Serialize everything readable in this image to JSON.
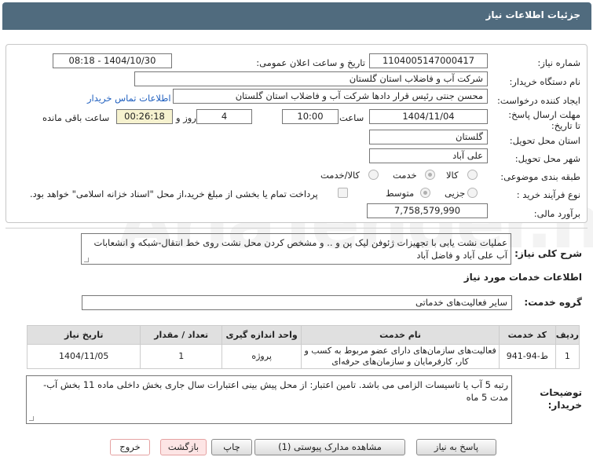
{
  "header": {
    "title": "جزئیات اطلاعات نیاز"
  },
  "watermark": "AriaTender.net",
  "form": {
    "need_number_label": "شماره نیاز:",
    "need_number": "1104005147000417",
    "announce_label": "تاریخ و ساعت اعلان عمومی:",
    "announce_value": "1404/10/30 - 08:18",
    "buyer_label": "نام دستگاه خریدار:",
    "buyer_value": "شرکت آب و فاضلاب استان گلستان",
    "creator_label": "ایجاد کننده درخواست:",
    "creator_value": "محسن جنتی رئیس قرار دادها شرکت آب و فاضلاب استان گلستان",
    "contact_link": "اطلاعات تماس خریدار",
    "deadline_label": "مهلت ارسال پاسخ: تا تاریخ:",
    "deadline_date": "1404/11/04",
    "time_label": "ساعت",
    "deadline_time": "10:00",
    "days_value": "4",
    "days_label": "روز و",
    "remaining_time": "00:26:18",
    "remaining_label": "ساعت باقی مانده",
    "province_label": "استان محل تحویل:",
    "province_value": "گلستان",
    "city_label": "شهر محل تحویل:",
    "city_value": "علی آباد",
    "category_label": "طبقه بندی موضوعی:",
    "category_options": [
      "کالا",
      "خدمت",
      "کالا/خدمت"
    ],
    "category_selected": "خدمت",
    "process_label": "نوع فرآیند خرید :",
    "process_options": [
      "جزیی",
      "متوسط"
    ],
    "process_selected": "متوسط",
    "treasury_note": "پرداخت تمام یا بخشی از مبلغ خرید،از محل \"اسناد خزانه اسلامی\" خواهد بود.",
    "budget_label": "برآورد مالی:",
    "budget_value": "7,758,579,990"
  },
  "summary": {
    "label": "شرح کلی نیاز:",
    "value": "عملیات نشت یابی با تجهیزات ژئوفن لیک پن و .. و مشخص کردن محل نشت روی خط انتقال-شبکه و انشعابات آب علی آباد و فاضل آباد"
  },
  "services": {
    "section_title": "اطلاعات خدمات مورد نیاز",
    "group_label": "گروه خدمت:",
    "group_value": "سایر فعالیت‌های خدماتی",
    "columns": [
      "ردیف",
      "کد خدمت",
      "نام خدمت",
      "واحد اندازه گیری",
      "تعداد / مقدار",
      "تاریخ نیاز"
    ],
    "rows": [
      {
        "row": "1",
        "code": "ط-94-941",
        "name": "فعالیت‌های سازمان‌های دارای عضو مربوط به کسب و کار، کارفرمایان و سازمان‌های حرفه‌ای",
        "unit": "پروژه",
        "qty": "1",
        "date": "1404/11/05"
      }
    ]
  },
  "notes": {
    "label": "توضیحات خریدار:",
    "value": "رتبه 5 آب یا تاسیسات الزامی می باشد. تامین اعتبار: از محل پیش بینی اعتبارات سال جاری بخش داخلی ماده 11 بخش آب- مدت 5 ماه"
  },
  "buttons": {
    "reply": "پاسخ به نیاز",
    "attachments": "مشاهده مدارک پیوستی (1)",
    "print": "چاپ",
    "back": "بازگشت",
    "exit": "خروج"
  }
}
